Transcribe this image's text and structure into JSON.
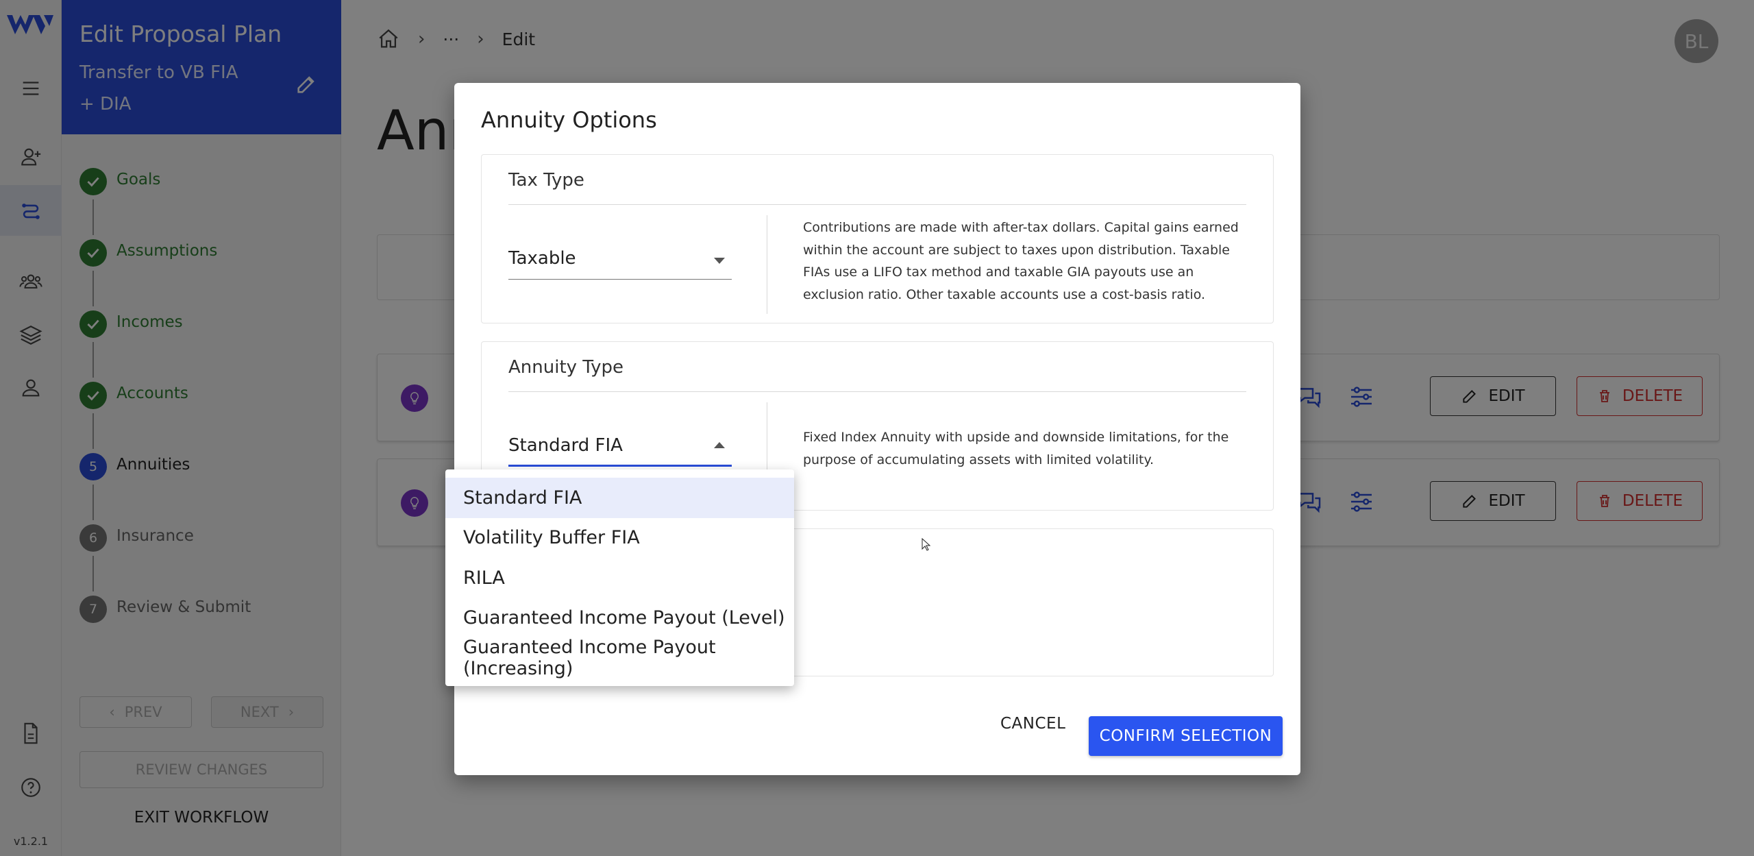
{
  "app": {
    "version": "v1.2.1",
    "rail_icons": [
      "menu-icon",
      "add-person-icon",
      "route-icon",
      "group-icon",
      "layers-icon",
      "person-icon",
      "document-icon",
      "help-icon"
    ]
  },
  "workflow": {
    "title": "Edit Proposal Plan",
    "subtitle": "Transfer to VB FIA + DIA",
    "steps": [
      {
        "number": "1",
        "label": "Goals",
        "status": "done"
      },
      {
        "number": "2",
        "label": "Assumptions",
        "status": "done"
      },
      {
        "number": "3",
        "label": "Incomes",
        "status": "done"
      },
      {
        "number": "4",
        "label": "Accounts",
        "status": "done"
      },
      {
        "number": "5",
        "label": "Annuities",
        "status": "active"
      },
      {
        "number": "6",
        "label": "Insurance",
        "status": "pending"
      },
      {
        "number": "7",
        "label": "Review & Submit",
        "status": "pending"
      }
    ],
    "prev_label": "PREV",
    "next_label": "NEXT",
    "review_changes_label": "REVIEW CHANGES",
    "exit_label": "EXIT WORKFLOW"
  },
  "header": {
    "breadcrumb": {
      "ellipsis": "···",
      "current": "Edit"
    },
    "avatar_initials": "BL",
    "page_title": "Ann"
  },
  "rows": [
    {
      "edit_label": "EDIT",
      "delete_label": "DELETE"
    },
    {
      "edit_label": "EDIT",
      "delete_label": "DELETE"
    }
  ],
  "dialog": {
    "title": "Annuity Options",
    "tax_type": {
      "title": "Tax Type",
      "value": "Taxable",
      "description": "Contributions are made with after-tax dollars. Capital gains earned within the account are subject to taxes upon distribution. Taxable FIAs use a LIFO tax method and taxable GIA payouts use an exclusion ratio. Other taxable accounts use a cost-basis ratio."
    },
    "annuity_type": {
      "title": "Annuity Type",
      "value": "Standard FIA",
      "description": "Fixed Index Annuity with upside and downside limitations, for the purpose of accumulating assets with limited volatility."
    },
    "menu_options": [
      "Standard FIA",
      "Volatility Buffer FIA",
      "RILA",
      "Guaranteed Income Payout (Level)",
      "Guaranteed Income Payout (Increasing)"
    ],
    "cancel_label": "CANCEL",
    "confirm_label": "CONFIRM SELECTION"
  },
  "colors": {
    "brand_blue": "#2a4dd8",
    "success_green": "#2e7d32",
    "danger_red": "#d32f2f",
    "accent_purple": "#7b35c9"
  }
}
